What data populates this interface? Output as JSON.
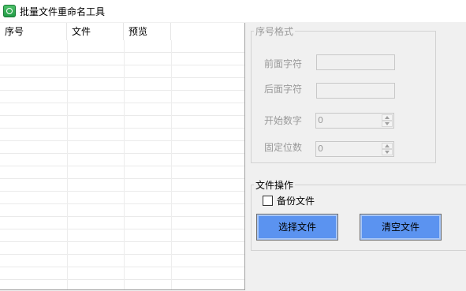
{
  "window": {
    "title": "批量文件重命名工具",
    "icon": "app-icon"
  },
  "file_list": {
    "columns": [
      "序号",
      "文件",
      "预览"
    ],
    "rows": []
  },
  "sequence_format": {
    "legend": "序号格式",
    "prefix_label": "前面字符",
    "prefix_value": "",
    "suffix_label": "后面字符",
    "suffix_value": "",
    "start_label": "开始数字",
    "start_value": "0",
    "digits_label": "固定位数",
    "digits_value": "0"
  },
  "file_operations": {
    "legend": "文件操作",
    "backup_label": "备份文件",
    "backup_checked": false,
    "select_button": "选择文件",
    "clear_button": "清空文件"
  },
  "colors": {
    "button_fill": "#5b93f0",
    "disabled_text": "#9a9a9a",
    "window_bg": "#f0f0f0"
  }
}
